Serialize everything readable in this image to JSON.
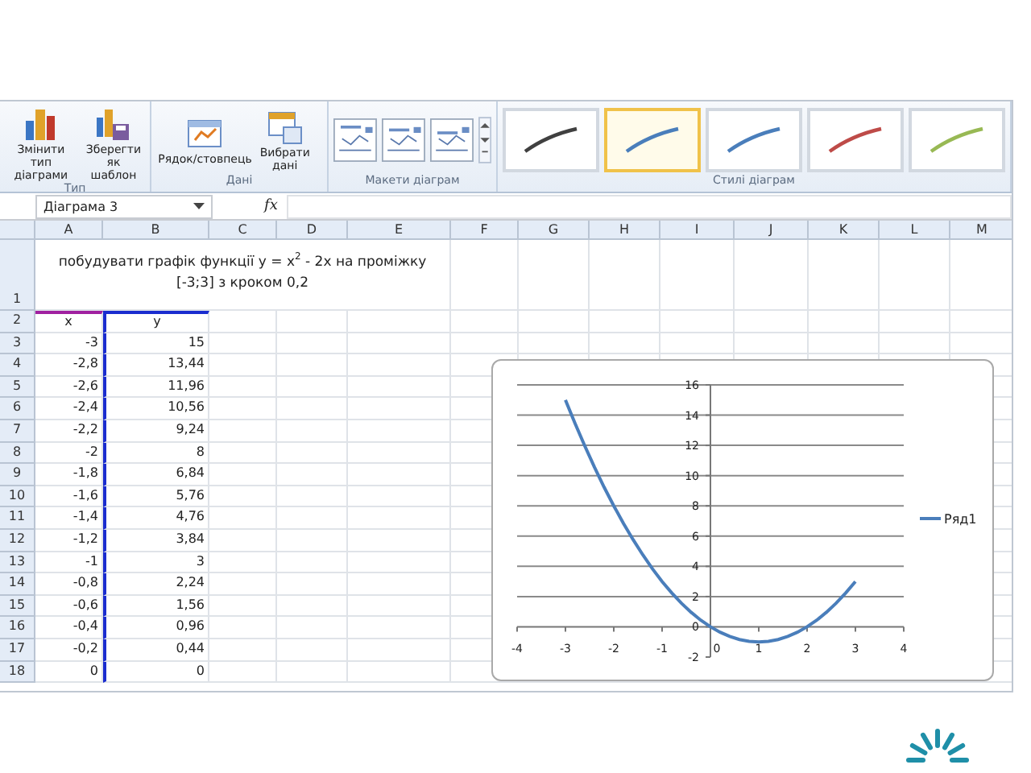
{
  "ribbon": {
    "groups": [
      {
        "label": "Тип",
        "buttons": [
          {
            "kind": "change",
            "label": "Змінити тип\nдіаграми"
          },
          {
            "kind": "save",
            "label": "Зберегти\nяк шаблон"
          }
        ]
      },
      {
        "label": "Дані",
        "buttons": [
          {
            "kind": "switch",
            "label": "Рядок/стовпець"
          },
          {
            "kind": "select",
            "label": "Вибрати\nдані"
          }
        ]
      },
      {
        "label": "Макети діаграм",
        "kind": "layouts"
      },
      {
        "label": "Стилі діаграм",
        "kind": "styles",
        "styles": [
          {
            "color": "#404040",
            "selected": false
          },
          {
            "color": "#4a7ebb",
            "selected": true
          },
          {
            "color": "#4a7ebb",
            "selected": false
          },
          {
            "color": "#be4b48",
            "selected": false
          },
          {
            "color": "#98b954",
            "selected": false
          }
        ]
      }
    ]
  },
  "formula_bar": {
    "name_box": "Діаграма 3",
    "function_label": "fx"
  },
  "sheet": {
    "columns": [
      "A",
      "B",
      "C",
      "D",
      "E",
      "F",
      "G",
      "H",
      "I",
      "J",
      "K",
      "L",
      "M"
    ],
    "rows": [
      {
        "header": "1",
        "kind": "title",
        "text": "побудувати графік функції y = x$^{2}$ - 2x на проміжку [-3;3] з кроком 0,2"
      },
      {
        "header": "2",
        "kind": "head",
        "cells": [
          "x",
          "y"
        ]
      },
      {
        "header": "3",
        "kind": "data",
        "cells": [
          "-3",
          "15"
        ]
      },
      {
        "header": "4",
        "kind": "data",
        "cells": [
          "-2,8",
          "13,44"
        ]
      },
      {
        "header": "5",
        "kind": "data",
        "cells": [
          "-2,6",
          "11,96"
        ]
      },
      {
        "header": "6",
        "kind": "data",
        "cells": [
          "-2,4",
          "10,56"
        ]
      },
      {
        "header": "7",
        "kind": "data",
        "cells": [
          "-2,2",
          "9,24"
        ]
      },
      {
        "header": "8",
        "kind": "data",
        "cells": [
          "-2",
          "8"
        ]
      },
      {
        "header": "9",
        "kind": "data",
        "cells": [
          "-1,8",
          "6,84"
        ]
      },
      {
        "header": "10",
        "kind": "data",
        "cells": [
          "-1,6",
          "5,76"
        ]
      },
      {
        "header": "11",
        "kind": "data",
        "cells": [
          "-1,4",
          "4,76"
        ]
      },
      {
        "header": "12",
        "kind": "data",
        "cells": [
          "-1,2",
          "3,84"
        ]
      },
      {
        "header": "13",
        "kind": "data",
        "cells": [
          "-1",
          "3"
        ]
      },
      {
        "header": "14",
        "kind": "data",
        "cells": [
          "-0,8",
          "2,24"
        ]
      },
      {
        "header": "15",
        "kind": "data",
        "cells": [
          "-0,6",
          "1,56"
        ]
      },
      {
        "header": "16",
        "kind": "data",
        "cells": [
          "-0,4",
          "0,96"
        ]
      },
      {
        "header": "17",
        "kind": "data",
        "cells": [
          "-0,2",
          "0,44"
        ]
      },
      {
        "header": "18",
        "kind": "data",
        "cells": [
          "0",
          "0"
        ]
      }
    ]
  },
  "chart": {
    "chart_data": {
      "type": "line",
      "x": [
        -3,
        -2.8,
        -2.6,
        -2.4,
        -2.2,
        -2,
        -1.8,
        -1.6,
        -1.4,
        -1.2,
        -1,
        -0.8,
        -0.6,
        -0.4,
        -0.2,
        0,
        0.2,
        0.4,
        0.6,
        0.8,
        1,
        1.2,
        1.4,
        1.6,
        1.8,
        2,
        2.2,
        2.4,
        2.6,
        2.8,
        3
      ],
      "series": [
        {
          "name": "Ряд1",
          "color": "#4a7ebb",
          "values": [
            15,
            13.44,
            11.96,
            10.56,
            9.24,
            8,
            6.84,
            5.76,
            4.76,
            3.84,
            3,
            2.24,
            1.56,
            0.96,
            0.44,
            0,
            -0.36,
            -0.64,
            -0.84,
            -0.96,
            -1,
            -0.96,
            -0.84,
            -0.64,
            -0.36,
            0,
            0.44,
            0.96,
            1.56,
            2.24,
            3
          ]
        }
      ],
      "xlim": [
        -4,
        4
      ],
      "ylim": [
        -2,
        16
      ],
      "xticks": [
        -4,
        -3,
        -2,
        -1,
        0,
        1,
        2,
        3,
        4
      ],
      "yticks": [
        -2,
        0,
        2,
        4,
        6,
        8,
        10,
        12,
        14,
        16
      ],
      "grid": true
    }
  }
}
